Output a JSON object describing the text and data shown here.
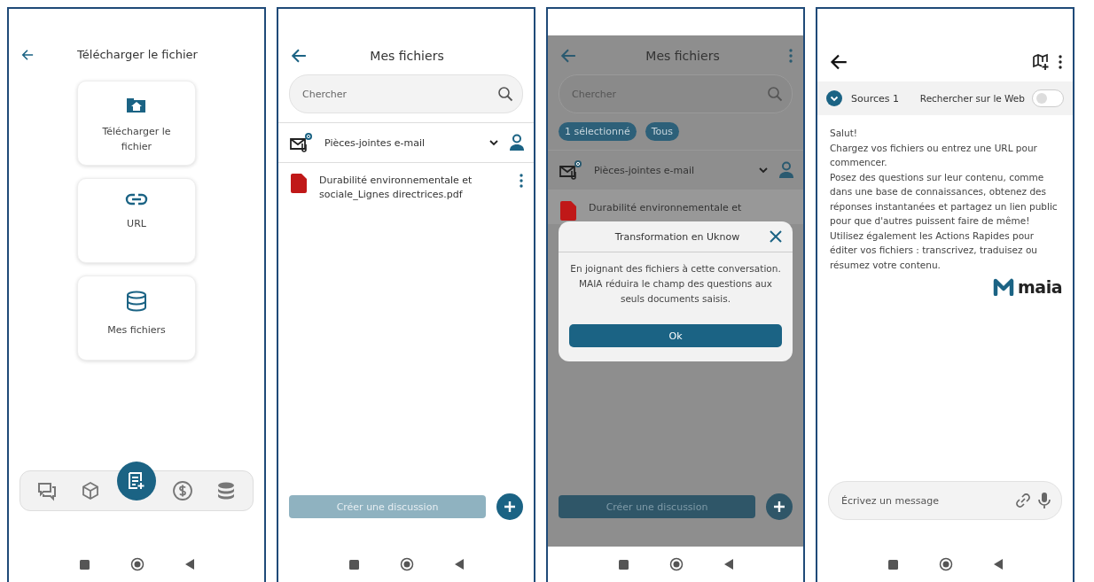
{
  "screens": [
    {
      "kind": "upload",
      "title": "Télécharger le fichier",
      "options": [
        {
          "kind": "upload",
          "label": "Télécharger le fichier"
        },
        {
          "kind": "link",
          "label": "URL"
        },
        {
          "kind": "database",
          "label": "Mes fichiers"
        }
      ],
      "nav": [
        {
          "kind": "chat",
          "selected": false
        },
        {
          "kind": "cube",
          "selected": false
        },
        {
          "kind": "compose",
          "selected": true
        },
        {
          "kind": "dollar",
          "selected": false
        },
        {
          "kind": "database",
          "selected": false
        }
      ]
    },
    {
      "kind": "files",
      "title": "Mes fichiers",
      "search": {
        "placeholder": "Chercher"
      },
      "folder": {
        "label": "Pièces-jointes e-mail"
      },
      "files": [
        {
          "name": "Durabilité environnementale et sociale_Lignes directrices.pdf"
        }
      ],
      "create_button": {
        "label": "Créer une discussion",
        "disabled": true
      }
    },
    {
      "kind": "files",
      "title": "Mes fichiers",
      "has_menu": true,
      "search": {
        "placeholder": "Chercher"
      },
      "chips": [
        "1 sélectionné",
        "Tous"
      ],
      "folder": {
        "label": "Pièces-jointes e-mail"
      },
      "files": [
        {
          "name": "Durabilité environnementale et"
        }
      ],
      "create_button": {
        "label": "Créer une discussion",
        "disabled": false
      },
      "dialog": {
        "title": "Transformation en Uknow",
        "message": "En joignant des fichiers à cette conversation. MAIA réduira le champ des questions aux seuls documents saisis.",
        "button": "Ok"
      }
    },
    {
      "kind": "chat",
      "sources": "Sources 1",
      "web_search": {
        "label": "Rechercher sur le Web",
        "on": false
      },
      "message_lines": [
        "Salut!",
        "Chargez vos fichiers ou entrez une URL pour commencer.",
        "Posez des questions sur leur contenu, comme dans une base de connaissances, obtenez des réponses instantanées et partagez un lien public pour que d'autres puissent faire de même!",
        "Utilisez également les Actions Rapides pour éditer vos fichiers : transcrivez, traduisez ou résumez votre contenu."
      ],
      "logo_text": "maia",
      "composer": {
        "placeholder": "Écrivez un message"
      }
    }
  ]
}
